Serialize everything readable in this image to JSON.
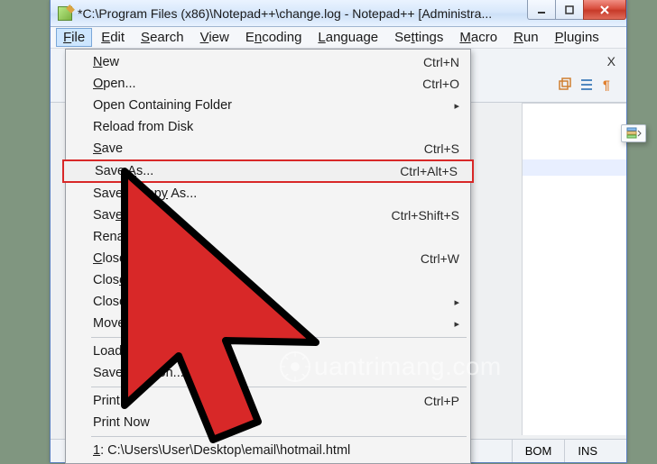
{
  "titlebar": {
    "text": "*C:\\Program Files (x86)\\Notepad++\\change.log - Notepad++ [Administra..."
  },
  "menubar": {
    "file": "File",
    "edit": "Edit",
    "search": "Search",
    "view": "View",
    "encoding": "Encoding",
    "language": "Language",
    "settings": "Settings",
    "macro": "Macro",
    "run": "Run",
    "plugins": "Plugins"
  },
  "tab_close": "X",
  "file_menu": {
    "new": {
      "label": "New",
      "shortcut": "Ctrl+N"
    },
    "open": {
      "label": "Open...",
      "shortcut": "Ctrl+O"
    },
    "open_containing": {
      "label": "Open Containing Folder"
    },
    "reload": {
      "label": "Reload from Disk"
    },
    "save": {
      "label": "Save",
      "shortcut": "Ctrl+S"
    },
    "save_as": {
      "label": "Save As...",
      "shortcut": "Ctrl+Alt+S"
    },
    "save_copy": {
      "label": "Save a Copy As..."
    },
    "save_all": {
      "label": "Save All",
      "shortcut": "Ctrl+Shift+S"
    },
    "rename": {
      "label": "Rename..."
    },
    "close": {
      "label": "Close",
      "shortcut": "Ctrl+W"
    },
    "close_all": {
      "label": "Close All"
    },
    "close_more": {
      "label": "Close More"
    },
    "move_to": {
      "label": "Move to"
    },
    "load_session": {
      "label": "Load Session..."
    },
    "save_session": {
      "label": "Save Session..."
    },
    "print": {
      "label": "Print...",
      "shortcut": "Ctrl+P"
    },
    "print_now": {
      "label": "Print Now"
    },
    "recent1": {
      "label": "1: C:\\Users\\User\\Desktop\\email\\hotmail.html"
    }
  },
  "statusbar": {
    "bom": "BOM",
    "ins": "INS"
  },
  "watermark": {
    "text": "uantrimang.com"
  }
}
